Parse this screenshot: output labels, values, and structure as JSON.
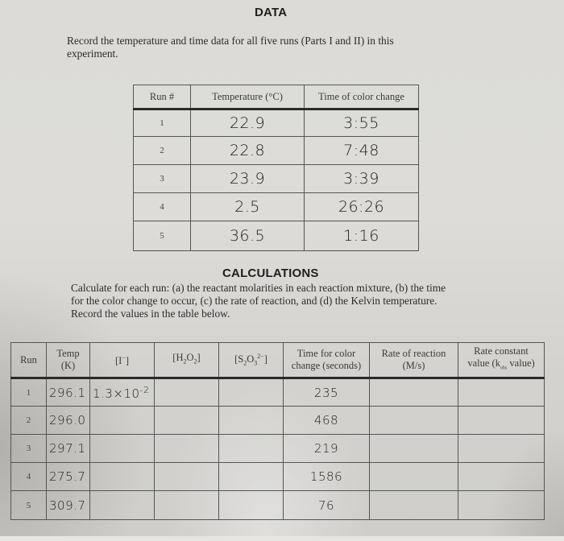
{
  "data_section": {
    "heading": "DATA",
    "instructions_line1": "Record the temperature and time data for all five runs (Parts I and II) in this",
    "instructions_line2": "experiment."
  },
  "data_table": {
    "headers": [
      "Run #",
      "Temperature (°C)",
      "Time of color change"
    ],
    "rows": [
      {
        "run": "1",
        "temperature": "22.9",
        "time": "3:55"
      },
      {
        "run": "2",
        "temperature": "22.8",
        "time": "7:48"
      },
      {
        "run": "3",
        "temperature": "23.9",
        "time": "3:39"
      },
      {
        "run": "4",
        "temperature": "2.5",
        "time": "26:26"
      },
      {
        "run": "5",
        "temperature": "36.5",
        "time": "1:16"
      }
    ]
  },
  "calculations_section": {
    "heading": "CALCULATIONS",
    "instructions_line1": "Calculate for each run: (a) the reactant molarities in each reaction mixture, (b) the time",
    "instructions_line2": "for the color change to occur, (c) the rate of reaction, and (d) the Kelvin temperature.",
    "instructions_line3": "Record the values in the table below."
  },
  "calc_table": {
    "headers": {
      "run": "Run",
      "temp_line1": "Temp",
      "temp_line2": "(K)",
      "iodide_base": "[I",
      "iodide_sup": "−",
      "iodide_close": "]",
      "h2o2_a": "[H",
      "h2o2_sub1": "2",
      "h2o2_b": "O",
      "h2o2_sub2": "2",
      "h2o2_close": "]",
      "s2o3_a": "[S",
      "s2o3_sub1": "2",
      "s2o3_b": "O",
      "s2o3_sub2": "3",
      "s2o3_sup": "2−",
      "s2o3_close": "]",
      "time_line1": "Time for color",
      "time_line2": "change (seconds)",
      "rate_line1": "Rate of reaction",
      "rate_line2": "(M/s)",
      "k_line1": "Rate constant",
      "k_line2a": "value (k",
      "k_sub": "obs",
      "k_line2b": " value)"
    },
    "rows": [
      {
        "run": "1",
        "temp_k": "296.1",
        "iodide": "1.3×10",
        "iodide_exp": "-2",
        "h2o2": "",
        "s2o3": "",
        "time_s": "235",
        "rate": "",
        "k": ""
      },
      {
        "run": "2",
        "temp_k": "296.0",
        "iodide": "",
        "iodide_exp": "",
        "h2o2": "",
        "s2o3": "",
        "time_s": "468",
        "rate": "",
        "k": ""
      },
      {
        "run": "3",
        "temp_k": "297.1",
        "iodide": "",
        "iodide_exp": "",
        "h2o2": "",
        "s2o3": "",
        "time_s": "219",
        "rate": "",
        "k": ""
      },
      {
        "run": "4",
        "temp_k": "275.7",
        "iodide": "",
        "iodide_exp": "",
        "h2o2": "",
        "s2o3": "",
        "time_s": "1586",
        "rate": "",
        "k": ""
      },
      {
        "run": "5",
        "temp_k": "309.7",
        "iodide": "",
        "iodide_exp": "",
        "h2o2": "",
        "s2o3": "",
        "time_s": "76",
        "rate": "",
        "k": ""
      }
    ]
  }
}
